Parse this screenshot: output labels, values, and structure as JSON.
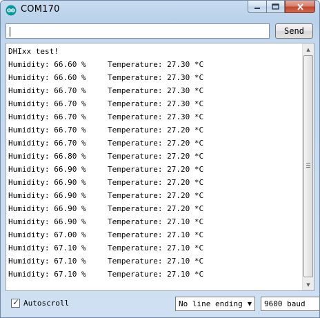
{
  "window": {
    "title": "COM170",
    "minimize_glyph": "—",
    "maximize_glyph": "□",
    "close_glyph": "✕"
  },
  "send_bar": {
    "input_value": "",
    "send_label": "Send"
  },
  "monitor": {
    "header": "DHIxx test!",
    "lines": [
      {
        "humidity": "Humidity: 66.60 %",
        "temperature": "Temperature: 27.30 *C"
      },
      {
        "humidity": "Humidity: 66.60 %",
        "temperature": "Temperature: 27.30 *C"
      },
      {
        "humidity": "Humidity: 66.70 %",
        "temperature": "Temperature: 27.30 *C"
      },
      {
        "humidity": "Humidity: 66.70 %",
        "temperature": "Temperature: 27.30 *C"
      },
      {
        "humidity": "Humidity: 66.70 %",
        "temperature": "Temperature: 27.30 *C"
      },
      {
        "humidity": "Humidity: 66.70 %",
        "temperature": "Temperature: 27.20 *C"
      },
      {
        "humidity": "Humidity: 66.70 %",
        "temperature": "Temperature: 27.20 *C"
      },
      {
        "humidity": "Humidity: 66.80 %",
        "temperature": "Temperature: 27.20 *C"
      },
      {
        "humidity": "Humidity: 66.90 %",
        "temperature": "Temperature: 27.20 *C"
      },
      {
        "humidity": "Humidity: 66.90 %",
        "temperature": "Temperature: 27.20 *C"
      },
      {
        "humidity": "Humidity: 66.90 %",
        "temperature": "Temperature: 27.20 *C"
      },
      {
        "humidity": "Humidity: 66.90 %",
        "temperature": "Temperature: 27.20 *C"
      },
      {
        "humidity": "Humidity: 66.90 %",
        "temperature": "Temperature: 27.10 *C"
      },
      {
        "humidity": "Humidity: 67.00 %",
        "temperature": "Temperature: 27.10 *C"
      },
      {
        "humidity": "Humidity: 67.10 %",
        "temperature": "Temperature: 27.10 *C"
      },
      {
        "humidity": "Humidity: 67.10 %",
        "temperature": "Temperature: 27.10 *C"
      },
      {
        "humidity": "Humidity: 67.10 %",
        "temperature": "Temperature: 27.10 *C"
      }
    ]
  },
  "footer": {
    "autoscroll_label": "Autoscroll",
    "autoscroll_checked": true,
    "line_ending_selected": "No line ending",
    "baud_selected": "9600 baud"
  },
  "icons": {
    "app": "arduino-infinity-icon",
    "scroll_up": "scroll-up-arrow-icon",
    "scroll_down": "scroll-down-arrow-icon",
    "dropdown": "chevron-down-icon",
    "check": "checkmark-icon"
  },
  "colors": {
    "app_icon": "#00979c",
    "close_button": "#c2462c",
    "titlebar": "#b9d1ea"
  }
}
